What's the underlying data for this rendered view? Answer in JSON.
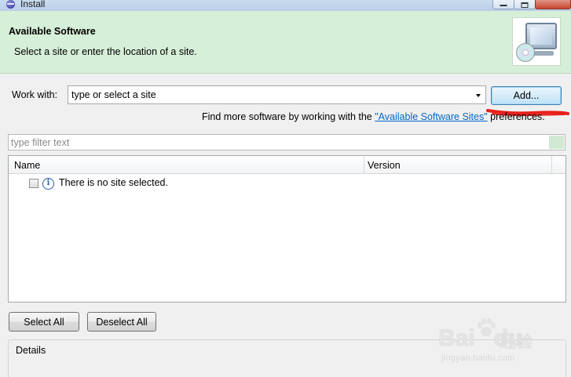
{
  "window": {
    "title": "Install"
  },
  "banner": {
    "title": "Available Software",
    "subtitle": "Select a site or enter the location of a site."
  },
  "work_with": {
    "label": "Work with:",
    "placeholder": "type or select a site",
    "add_button": "Add..."
  },
  "find_more": {
    "prefix": "Find more software by working with the ",
    "link": "\"Available Software Sites\"",
    "suffix": " preferences."
  },
  "filter": {
    "placeholder": "type filter text"
  },
  "table": {
    "columns": [
      "Name",
      "Version"
    ],
    "rows": [
      {
        "text": "There is no site selected.",
        "icon": "info-icon",
        "checked": false
      }
    ]
  },
  "buttons": {
    "select_all": "Select All",
    "deselect_all": "Deselect All"
  },
  "details": {
    "label": "Details"
  },
  "watermark": {
    "logo": "Bai",
    "logo_suffix": "du",
    "brand": "经验",
    "url": "jingyan.baidu.com"
  },
  "colors": {
    "banner_bg": "#d6efd8",
    "link": "#0066cc",
    "annotation": "#e8201c"
  }
}
